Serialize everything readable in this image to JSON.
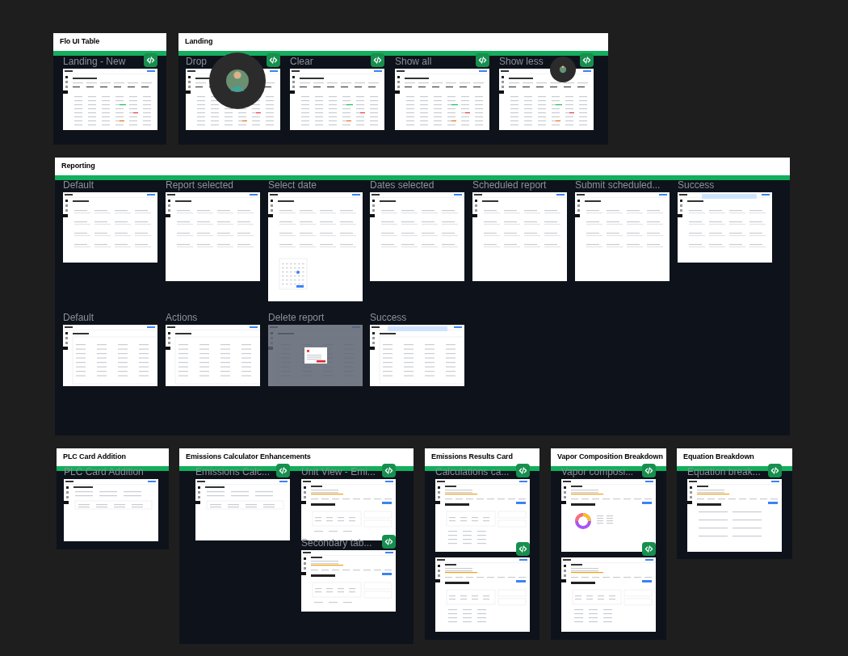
{
  "sections": [
    {
      "title": "Flo UI Table",
      "frames": [
        {
          "label": "Landing - New",
          "code": true,
          "kind": "table"
        }
      ]
    },
    {
      "title": "Landing",
      "frames": [
        {
          "label": "Drop",
          "code": true,
          "kind": "table"
        },
        {
          "label": "Clear",
          "code": true,
          "kind": "table"
        },
        {
          "label": "Show all",
          "code": true,
          "kind": "table"
        },
        {
          "label": "Show less",
          "code": true,
          "kind": "table"
        }
      ]
    },
    {
      "title": "Reporting",
      "frames": [
        {
          "label": "Default",
          "code": false,
          "kind": "cards"
        },
        {
          "label": "Report selected",
          "code": false,
          "kind": "cards"
        },
        {
          "label": "Select date",
          "code": false,
          "kind": "calendar"
        },
        {
          "label": "Dates selected",
          "code": false,
          "kind": "cards"
        },
        {
          "label": "Scheduled report",
          "code": false,
          "kind": "cards"
        },
        {
          "label": "Submit scheduled...",
          "code": false,
          "kind": "cards"
        },
        {
          "label": "Success",
          "code": false,
          "kind": "toastcards"
        },
        {
          "label": "Default",
          "code": false,
          "kind": "list"
        },
        {
          "label": "Actions",
          "code": false,
          "kind": "list"
        },
        {
          "label": "Delete report",
          "code": false,
          "kind": "modal"
        },
        {
          "label": "Success",
          "code": false,
          "kind": "toastlist"
        }
      ]
    },
    {
      "title": "PLC Card Addition",
      "frames": [
        {
          "label": "PLC Card Addition",
          "code": false,
          "kind": "form"
        }
      ]
    },
    {
      "title": "Emissions Calculator Enhancements",
      "frames": [
        {
          "label": "Emissions Calc...",
          "code": true,
          "kind": "form"
        },
        {
          "label": "Unit View - Emi...",
          "code": true,
          "kind": "detail"
        },
        {
          "label": "Secondary tab...",
          "code": true,
          "kind": "detail"
        }
      ]
    },
    {
      "title": "Emissions Results Card",
      "frames": [
        {
          "label": "Calculations ca...",
          "code": true,
          "kind": "detail"
        },
        {
          "code": true,
          "kind": "detail"
        }
      ]
    },
    {
      "title": "Vapor Composition Breakdown",
      "frames": [
        {
          "label": "Vapor composi...",
          "code": true,
          "kind": "donut"
        },
        {
          "code": true,
          "kind": "detail"
        }
      ]
    },
    {
      "title": "Equation Breakdown",
      "frames": [
        {
          "label": "Equation break...",
          "code": true,
          "kind": "equations"
        }
      ]
    }
  ]
}
